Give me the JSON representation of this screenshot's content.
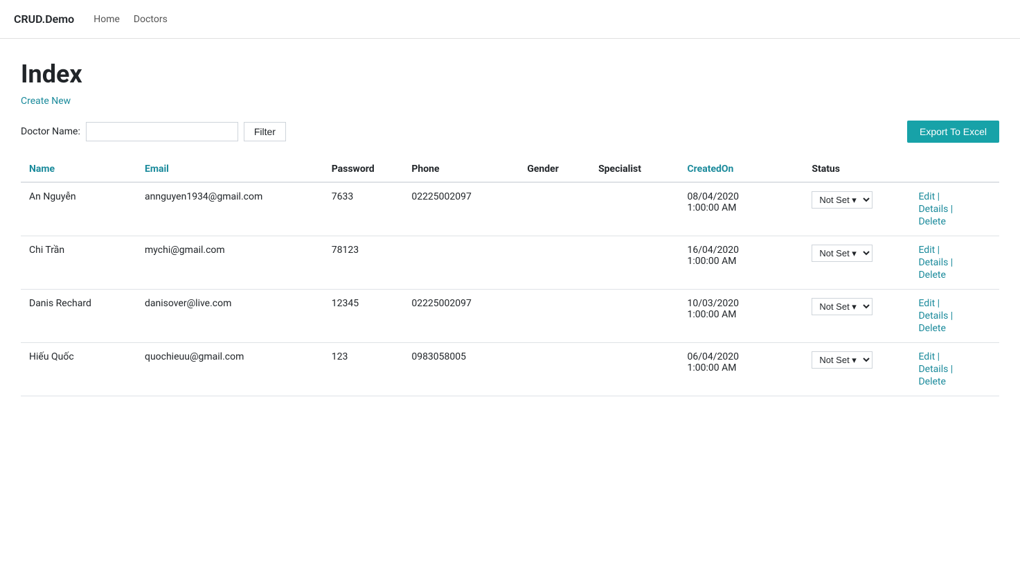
{
  "navbar": {
    "brand": "CRUD.Demo",
    "links": [
      {
        "label": "Home",
        "href": "#"
      },
      {
        "label": "Doctors",
        "href": "#"
      }
    ]
  },
  "page": {
    "title": "Index",
    "create_new_label": "Create New"
  },
  "filter": {
    "label": "Doctor Name:",
    "input_placeholder": "",
    "button_label": "Filter",
    "export_label": "Export To Excel"
  },
  "table": {
    "columns": [
      {
        "key": "name",
        "label": "Name",
        "colored": true
      },
      {
        "key": "email",
        "label": "Email",
        "colored": true
      },
      {
        "key": "password",
        "label": "Password",
        "colored": false
      },
      {
        "key": "phone",
        "label": "Phone",
        "colored": false
      },
      {
        "key": "gender",
        "label": "Gender",
        "colored": false
      },
      {
        "key": "specialist",
        "label": "Specialist",
        "colored": false
      },
      {
        "key": "createdon",
        "label": "CreatedOn",
        "colored": true
      },
      {
        "key": "status",
        "label": "Status",
        "colored": false
      }
    ],
    "rows": [
      {
        "name": "An Nguyễn",
        "email": "annguyen1934@gmail.com",
        "password": "7633",
        "phone": "02225002097",
        "gender": "",
        "specialist": "",
        "createdon": "08/04/2020\n1:00:00 AM",
        "status": "Not Set",
        "actions": [
          "Edit",
          "Details",
          "Delete"
        ]
      },
      {
        "name": "Chi Trần",
        "email": "mychi@gmail.com",
        "password": "78123",
        "phone": "",
        "gender": "",
        "specialist": "",
        "createdon": "16/04/2020\n1:00:00 AM",
        "status": "Not Set",
        "actions": [
          "Edit",
          "Details",
          "Delete"
        ]
      },
      {
        "name": "Danis Rechard",
        "email": "danisover@live.com",
        "password": "12345",
        "phone": "02225002097",
        "gender": "",
        "specialist": "",
        "createdon": "10/03/2020\n1:00:00 AM",
        "status": "Not Set",
        "actions": [
          "Edit",
          "Details",
          "Delete"
        ]
      },
      {
        "name": "Hiếu Quốc",
        "email": "quochieuu@gmail.com",
        "password": "123",
        "phone": "0983058005",
        "gender": "",
        "specialist": "",
        "createdon": "06/04/2020\n1:00:00 AM",
        "status": "Not Set",
        "actions": [
          "Edit",
          "Details",
          "Delete"
        ]
      }
    ]
  },
  "colors": {
    "accent": "#1a8a9b",
    "export_bg": "#17a2a8"
  }
}
